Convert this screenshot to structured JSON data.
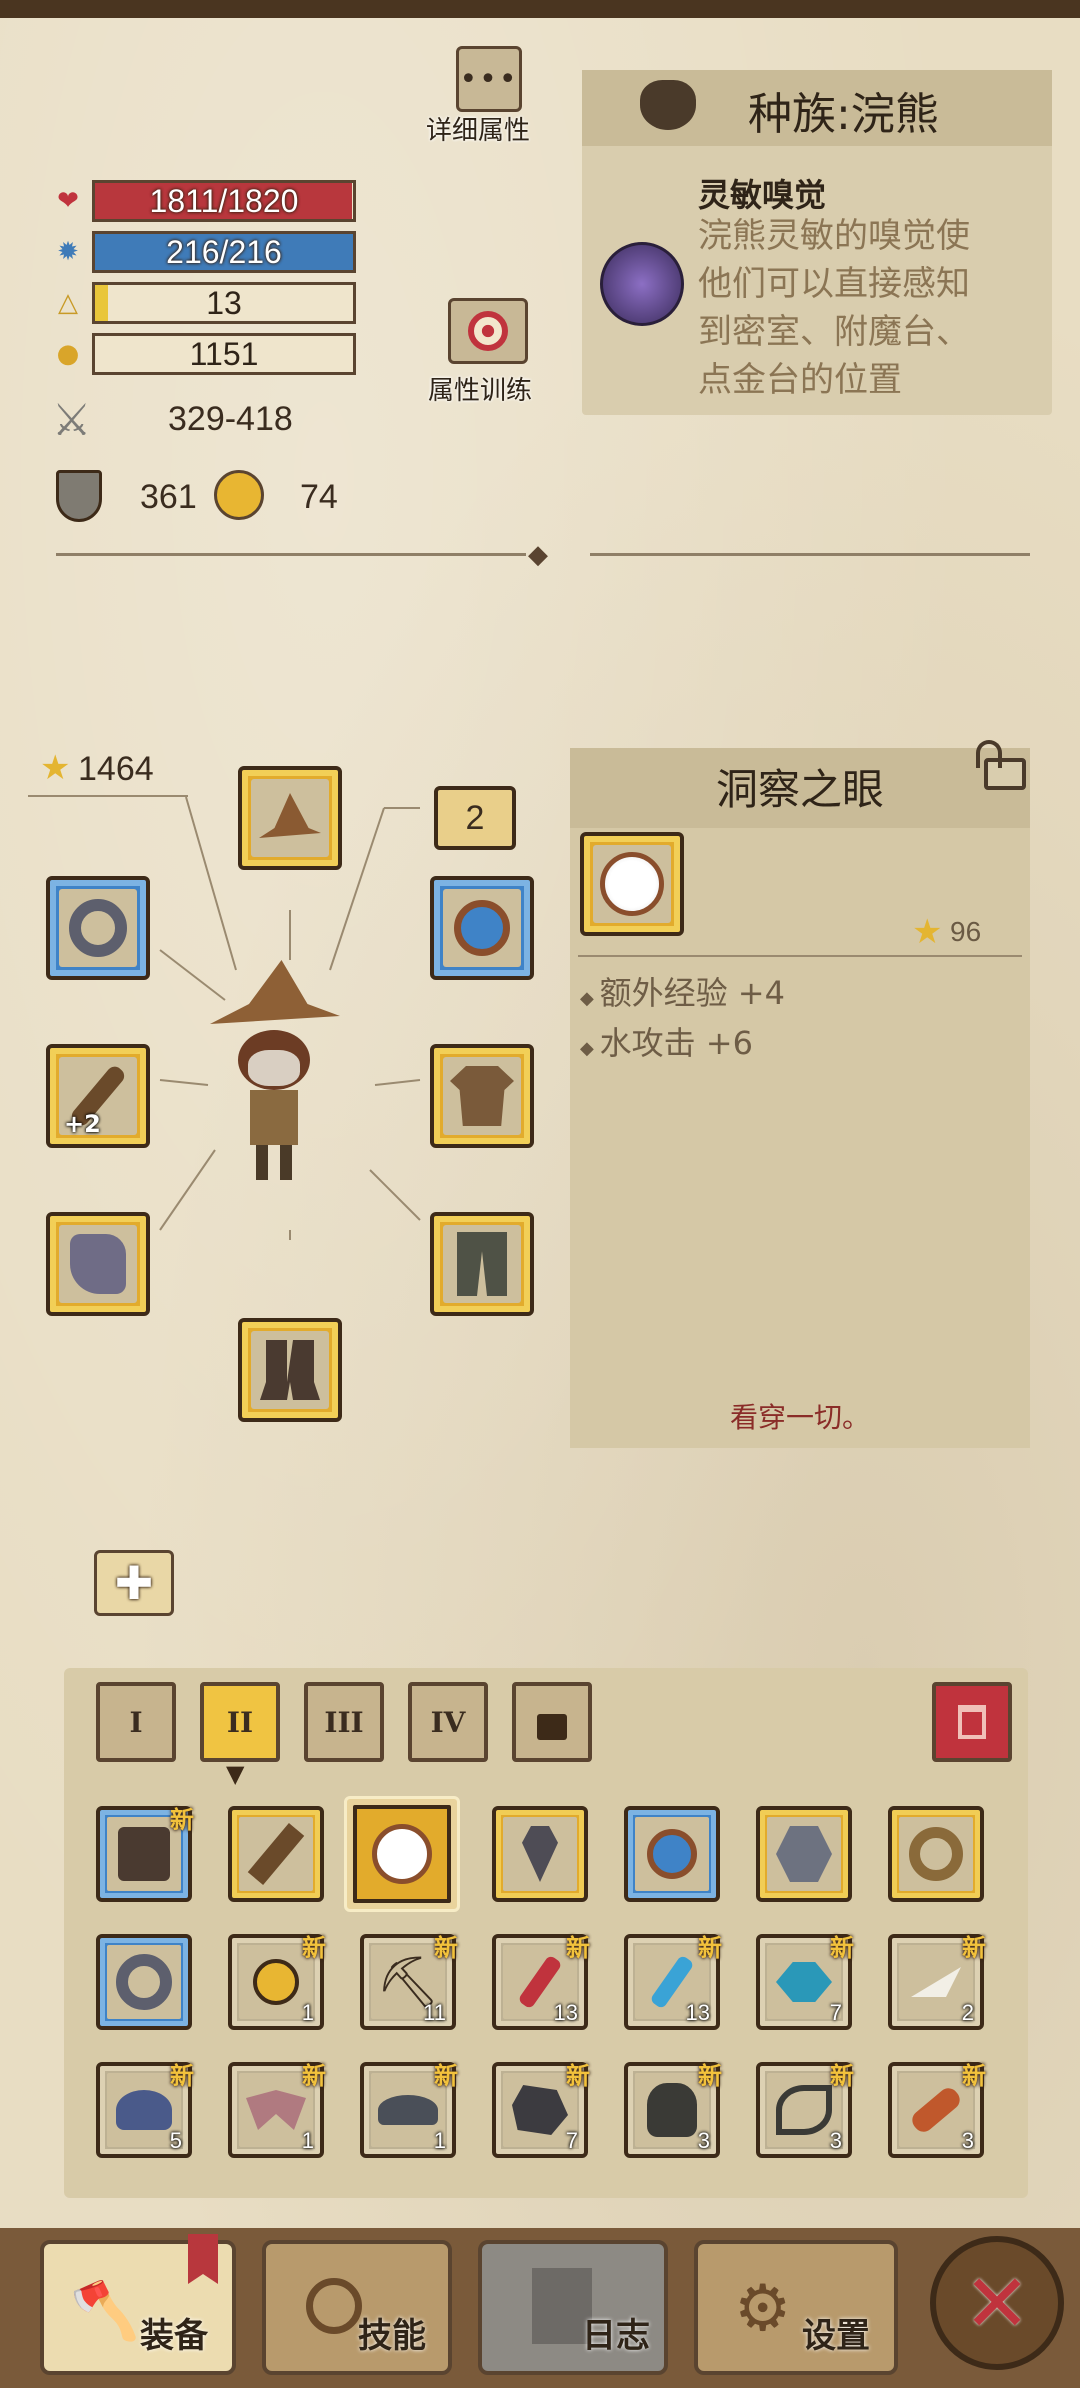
{
  "stats": {
    "hp": "1811/1820",
    "hp_fill": 0.995,
    "mana": "216/216",
    "mana_fill": 1.0,
    "level": "13",
    "level_fill": 0.05,
    "gold": "1151",
    "attack": "329-418",
    "armor": "361",
    "magic_resist": "74"
  },
  "buttons": {
    "details_label": "详细属性",
    "training_label": "属性训练"
  },
  "race": {
    "title": "种族:浣熊",
    "skill_name": "灵敏嗅觉",
    "skill_desc": "浣熊灵敏的嗅觉使他们可以直接感知到密室、附魔台、点金台的位置"
  },
  "equipment": {
    "star_total": "1464",
    "accessory_count": "2",
    "weapon_bonus": "+2"
  },
  "item": {
    "name": "洞察之眼",
    "star": "96",
    "attrs": [
      "额外经验 +4",
      "水攻击 +6"
    ],
    "flavor": "看穿一切。"
  },
  "inventory": {
    "tabs": [
      "I",
      "II",
      "III",
      "IV"
    ],
    "new_label": "新",
    "counts": {
      "r2c2": "1",
      "r2c3": "11",
      "r2c4": "13",
      "r2c5": "13",
      "r2c6": "7",
      "r2c7": "2",
      "r3c1": "5",
      "r3c2": "1",
      "r3c3": "1",
      "r3c4": "7",
      "r3c5": "3",
      "r3c6": "3",
      "r3c7": "3"
    }
  },
  "nav": {
    "equip": "装备",
    "skills": "技能",
    "log": "日志",
    "settings": "设置"
  },
  "colors": {
    "hp": "#b8373d",
    "mana": "#3f7bb8",
    "level": "#e9c63a",
    "gold_slot": "#e2ab2c",
    "blue_slot": "#3f83c7"
  }
}
